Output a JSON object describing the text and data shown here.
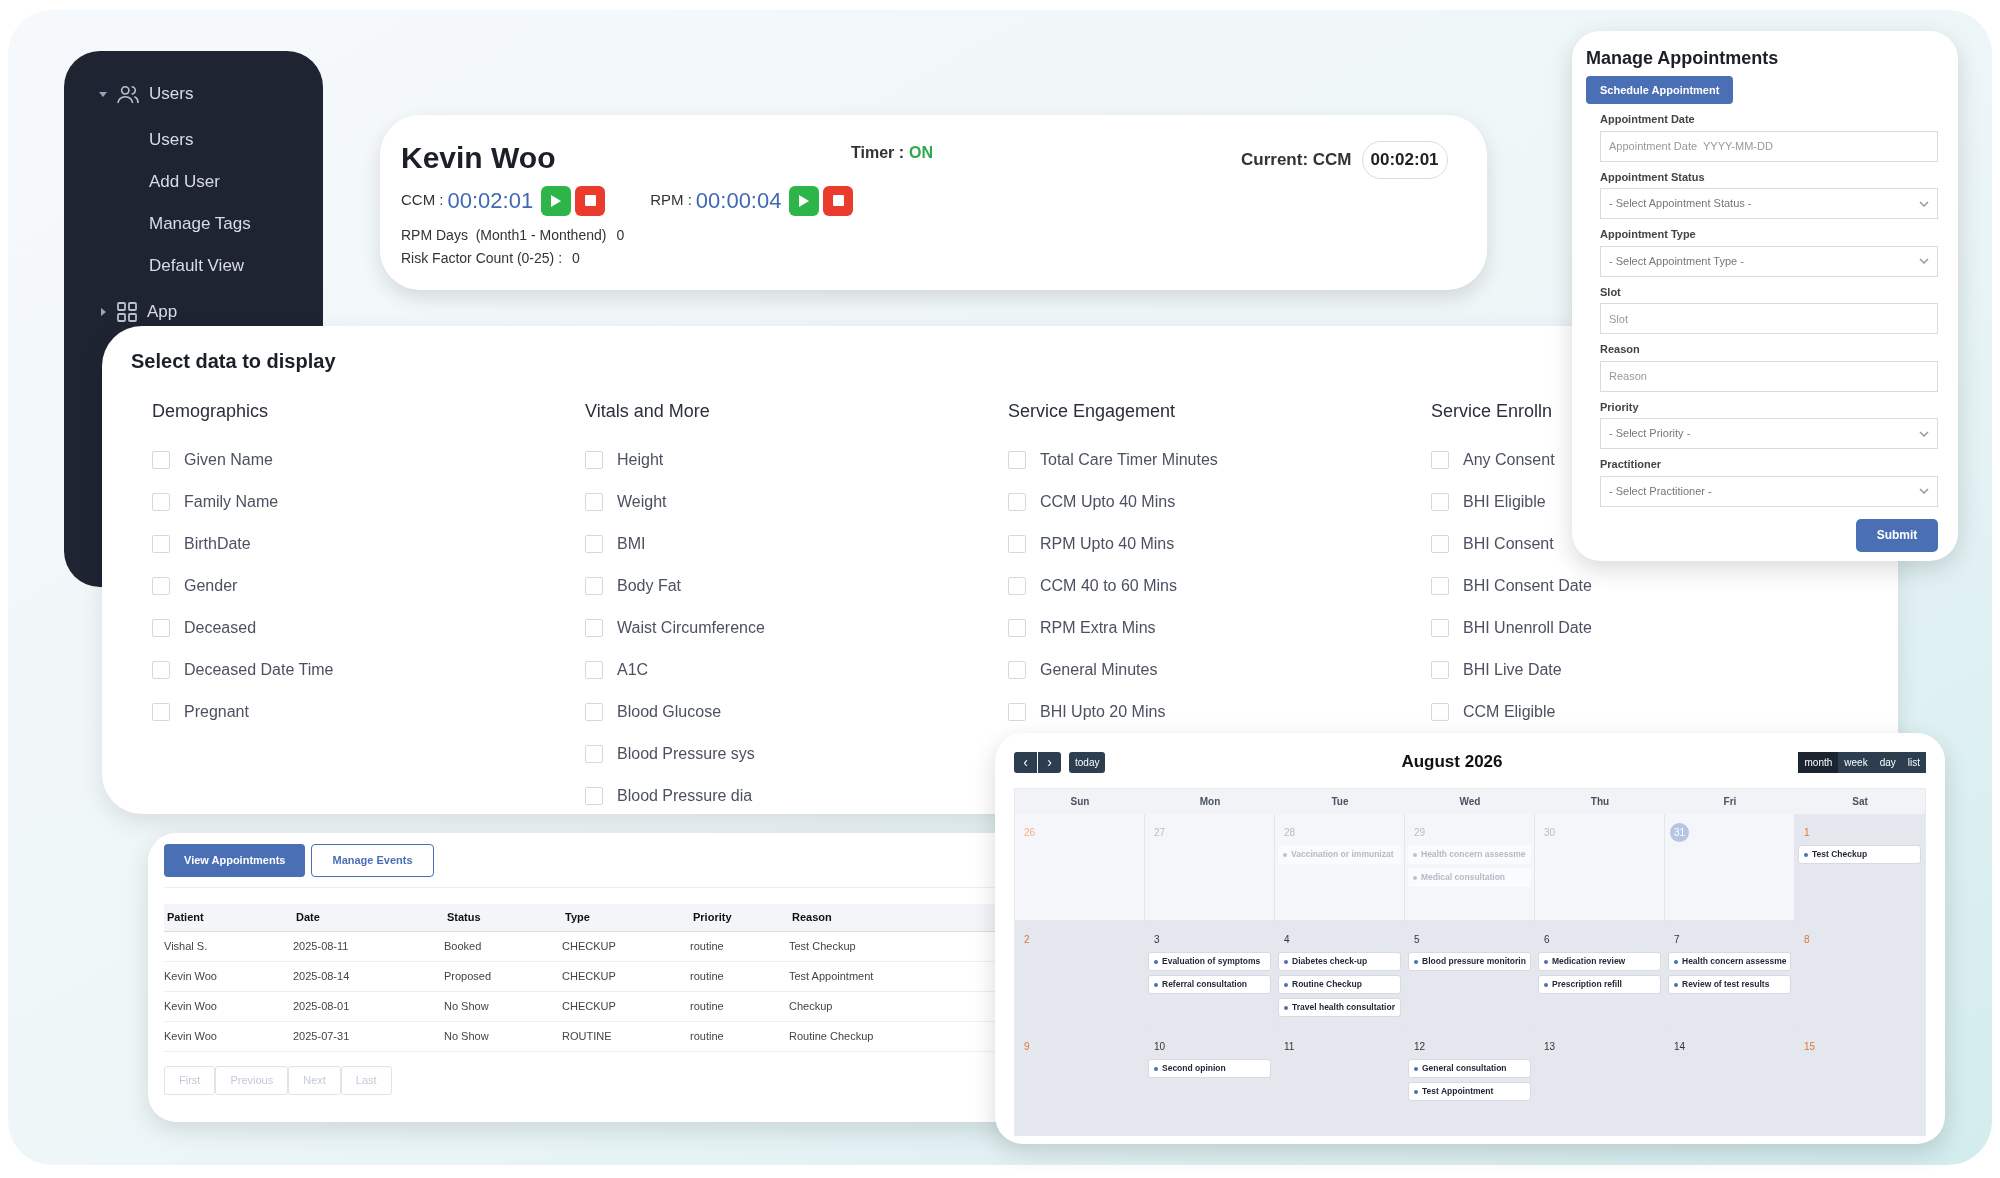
{
  "sidebar": {
    "items": [
      {
        "label": "Users",
        "expanded": true,
        "children": [
          "Users",
          "Add User",
          "Manage Tags",
          "Default View"
        ]
      },
      {
        "label": "App",
        "expanded": false
      }
    ]
  },
  "patient": {
    "name": "Kevin Woo",
    "timer_label": "Timer :",
    "timer_state": "ON",
    "timer_on": true,
    "current_label": "Current: CCM",
    "current_time": "00:02:01",
    "timers": [
      {
        "label": "CCM :",
        "time": "00:02:01"
      },
      {
        "label": "RPM :",
        "time": "00:00:04"
      }
    ],
    "stats": [
      {
        "label": "RPM Days  (Month1 - Monthend)",
        "value": "0"
      },
      {
        "label": "Risk Factor Count (0-25) :",
        "value": "0"
      }
    ]
  },
  "select_data": {
    "title": "Select data to display",
    "columns": [
      {
        "title": "Demographics",
        "items": [
          {
            "label": "Given Name",
            "checked": false
          },
          {
            "label": "Family Name",
            "checked": false
          },
          {
            "label": "BirthDate",
            "checked": false
          },
          {
            "label": "Gender",
            "checked": false
          },
          {
            "label": "Deceased",
            "checked": false
          },
          {
            "label": "Deceased Date Time",
            "checked": false
          },
          {
            "label": "Pregnant",
            "checked": false
          }
        ]
      },
      {
        "title": "Vitals and More",
        "items": [
          {
            "label": "Height",
            "checked": false
          },
          {
            "label": "Weight",
            "checked": false
          },
          {
            "label": "BMI",
            "checked": false
          },
          {
            "label": "Body Fat",
            "checked": false
          },
          {
            "label": "Waist Circumference",
            "checked": false
          },
          {
            "label": "A1C",
            "checked": false
          },
          {
            "label": "Blood Glucose",
            "checked": false
          },
          {
            "label": "Blood Pressure sys",
            "checked": false
          },
          {
            "label": "Blood Pressure dia",
            "checked": false
          }
        ]
      },
      {
        "title": "Service Engagement",
        "items": [
          {
            "label": "Total Care Timer Minutes",
            "checked": false
          },
          {
            "label": "CCM Upto 40 Mins",
            "checked": false
          },
          {
            "label": "RPM Upto 40 Mins",
            "checked": false
          },
          {
            "label": "CCM 40 to 60 Mins",
            "checked": false
          },
          {
            "label": "RPM Extra Mins",
            "checked": false
          },
          {
            "label": "General Minutes",
            "checked": false
          },
          {
            "label": "BHI Upto 20 Mins",
            "checked": false
          }
        ]
      },
      {
        "title": "Service Enrolln",
        "items": [
          {
            "label": "Any Consent",
            "checked": false
          },
          {
            "label": "BHI Eligible",
            "checked": false
          },
          {
            "label": "BHI Consent",
            "checked": false
          },
          {
            "label": "BHI Consent Date",
            "checked": false
          },
          {
            "label": "BHI Unenroll Date",
            "checked": false
          },
          {
            "label": "BHI Live Date",
            "checked": false
          },
          {
            "label": "CCM Eligible",
            "checked": false
          }
        ]
      }
    ]
  },
  "manage_appointments": {
    "title": "Manage Appointments",
    "schedule_button": "Schedule Appointment",
    "fields": [
      {
        "kind": "input",
        "label": "Appointment Date",
        "placeholder": "Appointment Date  YYYY-MM-DD"
      },
      {
        "kind": "select",
        "label": "Appointment Status",
        "placeholder": "- Select Appointment Status -"
      },
      {
        "kind": "select",
        "label": "Appointment Type",
        "placeholder": "- Select Appointment Type -"
      },
      {
        "kind": "input",
        "label": "Slot",
        "placeholder": "Slot"
      },
      {
        "kind": "input",
        "label": "Reason",
        "placeholder": "Reason"
      },
      {
        "kind": "select",
        "label": "Priority",
        "placeholder": "- Select Priority -"
      },
      {
        "kind": "select",
        "label": "Practitioner",
        "placeholder": "- Select Practitioner -"
      }
    ],
    "submit_button": "Submit"
  },
  "appointments": {
    "tabs": [
      {
        "label": "View Appointments",
        "selected": true
      },
      {
        "label": "Manage Events",
        "selected": false
      }
    ],
    "table": {
      "columns": [
        "Patient",
        "Date",
        "Status",
        "Type",
        "Priority",
        "Reason"
      ],
      "rows": [
        [
          "Vishal S.",
          "2025-08-11",
          "Booked",
          "CHECKUP",
          "routine",
          "Test Checkup"
        ],
        [
          "Kevin Woo",
          "2025-08-14",
          "Proposed",
          "CHECKUP",
          "routine",
          "Test Appointment"
        ],
        [
          "Kevin Woo",
          "2025-08-01",
          "No Show",
          "CHECKUP",
          "routine",
          "Checkup"
        ],
        [
          "Kevin Woo",
          "2025-07-31",
          "No Show",
          "ROUTINE",
          "routine",
          "Routine Checkup"
        ]
      ]
    },
    "pagination": [
      {
        "label": "First",
        "disabled": true
      },
      {
        "label": "Previous",
        "disabled": true
      },
      {
        "label": "Next",
        "disabled": true
      },
      {
        "label": "Last",
        "disabled": true
      }
    ]
  },
  "calendar": {
    "prev": "‹",
    "next": "›",
    "today_button": "today",
    "title": "August 2026",
    "views": [
      {
        "label": "month",
        "selected": true
      },
      {
        "label": "week",
        "selected": false
      },
      {
        "label": "day",
        "selected": false
      },
      {
        "label": "list",
        "selected": false
      }
    ],
    "weekdays": [
      "Sun",
      "Mon",
      "Tue",
      "Wed",
      "Thu",
      "Fri",
      "Sat"
    ],
    "weeks": [
      {
        "days": [
          {
            "number": "26",
            "muted": true,
            "weekend": true,
            "today": false
          },
          {
            "number": "27",
            "muted": true,
            "weekend": false,
            "today": false
          },
          {
            "number": "28",
            "muted": true,
            "weekend": false,
            "today": false,
            "events": [
              {
                "title": "Vaccination or immunizat",
                "muted": true
              }
            ]
          },
          {
            "number": "29",
            "muted": true,
            "weekend": false,
            "today": false,
            "events": [
              {
                "title": "Health concern assessme",
                "muted": true
              },
              {
                "title": "Medical consultation",
                "muted": true
              }
            ]
          },
          {
            "number": "30",
            "muted": true,
            "weekend": false,
            "today": false
          },
          {
            "number": "31",
            "muted": true,
            "weekend": false,
            "today": true
          },
          {
            "number": "1",
            "muted": false,
            "weekend": true,
            "today": false,
            "events": [
              {
                "title": "Test Checkup",
                "muted": false
              }
            ]
          }
        ]
      },
      {
        "days": [
          {
            "number": "2",
            "muted": false,
            "weekend": true,
            "today": false
          },
          {
            "number": "3",
            "muted": false,
            "weekend": false,
            "today": false,
            "events": [
              {
                "title": "Evaluation of symptoms",
                "muted": false
              },
              {
                "title": "Referral consultation",
                "muted": false
              }
            ]
          },
          {
            "number": "4",
            "muted": false,
            "weekend": false,
            "today": false,
            "events": [
              {
                "title": "Diabetes check-up",
                "muted": false
              },
              {
                "title": "Routine Checkup",
                "muted": false
              },
              {
                "title": "Travel health consultatior",
                "muted": false
              }
            ]
          },
          {
            "number": "5",
            "muted": false,
            "weekend": false,
            "today": false,
            "events": [
              {
                "title": "Blood pressure monitorin",
                "muted": false
              }
            ]
          },
          {
            "number": "6",
            "muted": false,
            "weekend": false,
            "today": false,
            "events": [
              {
                "title": "Medication review",
                "muted": false
              },
              {
                "title": "Prescription refill",
                "muted": false
              }
            ]
          },
          {
            "number": "7",
            "muted": false,
            "weekend": false,
            "today": false,
            "events": [
              {
                "title": "Health concern assessme",
                "muted": false
              },
              {
                "title": "Review of test results",
                "muted": false
              }
            ]
          },
          {
            "number": "8",
            "muted": false,
            "weekend": true,
            "today": false
          }
        ]
      },
      {
        "days": [
          {
            "number": "9",
            "muted": false,
            "weekend": true,
            "today": false
          },
          {
            "number": "10",
            "muted": false,
            "weekend": false,
            "today": false,
            "events": [
              {
                "title": "Second opinion",
                "muted": false
              }
            ]
          },
          {
            "number": "11",
            "muted": false,
            "weekend": false,
            "today": false
          },
          {
            "number": "12",
            "muted": false,
            "weekend": false,
            "today": false,
            "events": [
              {
                "title": "General consultation",
                "muted": false
              },
              {
                "title": "Test Appointment",
                "muted": false
              }
            ]
          },
          {
            "number": "13",
            "muted": false,
            "weekend": false,
            "today": false
          },
          {
            "number": "14",
            "muted": false,
            "weekend": false,
            "today": false
          },
          {
            "number": "15",
            "muted": false,
            "weekend": true,
            "today": false
          }
        ]
      }
    ]
  }
}
